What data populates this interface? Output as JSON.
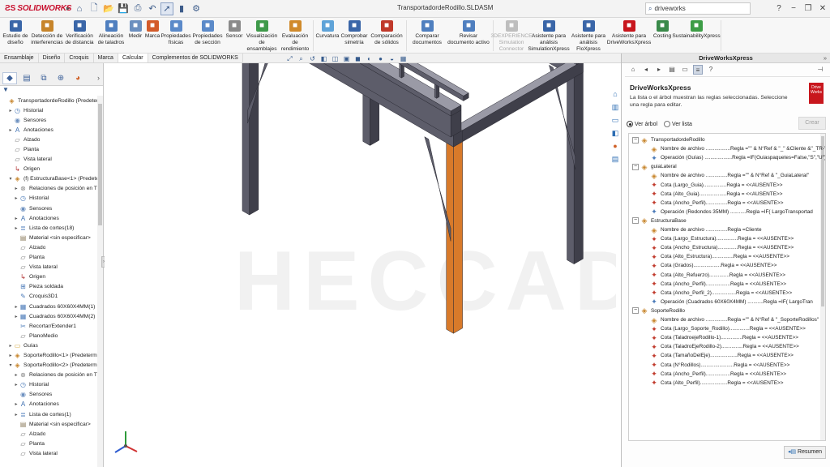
{
  "app": {
    "brand": "SOLIDWORKS",
    "doc_title": "TransportadordeRodillo.SLDASM",
    "search_text": "driveworks"
  },
  "ribbon": {
    "buttons": [
      {
        "label": "Estudio de diseño",
        "icon": "design-study-icon",
        "color": "#3a66a8"
      },
      {
        "label": "Detección de interferencias",
        "icon": "interference-icon",
        "color": "#c7852b"
      },
      {
        "label": "Verificación de distancia",
        "icon": "clearance-icon",
        "color": "#3a66a8"
      },
      {
        "label": "Alineación de taladros",
        "icon": "hole-align-icon",
        "color": "#4f7fbf"
      },
      {
        "label": "Medir",
        "icon": "measure-icon",
        "color": "#6b8fbf"
      },
      {
        "label": "Marca",
        "icon": "markup-icon",
        "color": "#d35b2a"
      },
      {
        "label": "Propiedades físicas",
        "icon": "mass-props-icon",
        "color": "#5b8ac9"
      },
      {
        "label": "Propiedades de sección",
        "icon": "section-props-icon",
        "color": "#5b8ac9"
      },
      {
        "label": "Sensor",
        "icon": "sensor-icon",
        "color": "#8a8a8a"
      },
      {
        "label": "Visualización de ensamblajes",
        "icon": "assembly-vis-icon",
        "color": "#3f9a4a"
      },
      {
        "label": "Evaluación de rendimiento",
        "icon": "performance-icon",
        "color": "#d08a2b"
      },
      {
        "label": "Curvatura",
        "icon": "curvature-icon",
        "color": "#5fa3d8"
      },
      {
        "label": "Comprobar simetría",
        "icon": "symmetry-icon",
        "color": "#3a66a8"
      },
      {
        "label": "Comparación de sólidos",
        "icon": "compare-solids-icon",
        "color": "#c0392b"
      },
      {
        "label": "Comparar documentos",
        "icon": "compare-docs-icon",
        "color": "#4f7fbf"
      },
      {
        "label": "Revisar documento activo",
        "icon": "check-doc-icon",
        "color": "#4f7fbf"
      },
      {
        "label": "3DEXPERIENCE Simulation Connector",
        "icon": "3dx-icon",
        "color": "#7a7a7a",
        "disabled": true
      },
      {
        "label": "Asistente para análisis SimulationXpress",
        "icon": "simxpress-icon",
        "color": "#3a66a8"
      },
      {
        "label": "Asistente para análisis FloXpress",
        "icon": "floxpress-icon",
        "color": "#3a66a8"
      },
      {
        "label": "Asistente para DriveWorksXpress",
        "icon": "driveworks-icon",
        "color": "#c8161d"
      },
      {
        "label": "Costing",
        "icon": "costing-icon",
        "color": "#3a8a4a"
      },
      {
        "label": "SustainabilityXpress",
        "icon": "sustainability-icon",
        "color": "#3d9d46"
      }
    ]
  },
  "cmd_tabs": [
    "Ensamblaje",
    "Diseño",
    "Croquis",
    "Marca",
    "Calcular",
    "Complementos de SOLIDWORKS"
  ],
  "cmd_tabs_active": 4,
  "feature_tree": [
    {
      "label": "TransportadordeRodillo  (Predetermi",
      "icon": "assembly-icon",
      "lvl": 0,
      "exp": ""
    },
    {
      "label": "Historial",
      "icon": "history-icon",
      "lvl": 1,
      "exp": "▸"
    },
    {
      "label": "Sensores",
      "icon": "sensor-icon",
      "lvl": 1,
      "exp": ""
    },
    {
      "label": "Anotaciones",
      "icon": "annotation-icon",
      "lvl": 1,
      "exp": "▸"
    },
    {
      "label": "Alzado",
      "icon": "plane-icon",
      "lvl": 1,
      "exp": ""
    },
    {
      "label": "Planta",
      "icon": "plane-icon",
      "lvl": 1,
      "exp": ""
    },
    {
      "label": "Vista lateral",
      "icon": "plane-icon",
      "lvl": 1,
      "exp": ""
    },
    {
      "label": "Origen",
      "icon": "origin-icon",
      "lvl": 1,
      "exp": ""
    },
    {
      "label": "(f) EstructuraBase<1> (Predetermi",
      "icon": "part-icon",
      "lvl": 1,
      "exp": "▾"
    },
    {
      "label": "Relaciones de posición en T",
      "icon": "mate-icon",
      "lvl": 2,
      "exp": "▸"
    },
    {
      "label": "Historial",
      "icon": "history-icon",
      "lvl": 2,
      "exp": "▸"
    },
    {
      "label": "Sensores",
      "icon": "sensor-icon",
      "lvl": 2,
      "exp": ""
    },
    {
      "label": "Anotaciones",
      "icon": "annotation-icon",
      "lvl": 2,
      "exp": "▸"
    },
    {
      "label": "Lista de cortes(18)",
      "icon": "cutlist-icon",
      "lvl": 2,
      "exp": "▸"
    },
    {
      "label": "Material <sin especificar>",
      "icon": "material-icon",
      "lvl": 2,
      "exp": ""
    },
    {
      "label": "Alzado",
      "icon": "plane-icon",
      "lvl": 2,
      "exp": ""
    },
    {
      "label": "Planta",
      "icon": "plane-icon",
      "lvl": 2,
      "exp": ""
    },
    {
      "label": "Vista lateral",
      "icon": "plane-icon",
      "lvl": 2,
      "exp": ""
    },
    {
      "label": "Origen",
      "icon": "origin-icon",
      "lvl": 2,
      "exp": ""
    },
    {
      "label": "Pieza soldada",
      "icon": "weldment-icon",
      "lvl": 2,
      "exp": ""
    },
    {
      "label": "Croquis3D1",
      "icon": "sketch-icon",
      "lvl": 2,
      "exp": ""
    },
    {
      "label": "Cuadrados 60X60X4MM(1)",
      "icon": "structural-icon",
      "lvl": 2,
      "exp": "▸"
    },
    {
      "label": "Cuadrados 60X60X4MM(2)",
      "icon": "structural-icon",
      "lvl": 2,
      "exp": "▸"
    },
    {
      "label": "Recortar/Extender1",
      "icon": "trim-icon",
      "lvl": 2,
      "exp": ""
    },
    {
      "label": "PlanoMedio",
      "icon": "plane-icon",
      "lvl": 2,
      "exp": ""
    },
    {
      "label": "Guías",
      "icon": "folder-icon",
      "lvl": 1,
      "exp": "▸"
    },
    {
      "label": "SoporteRodillo<1> (Predetermir",
      "icon": "part-icon",
      "lvl": 1,
      "exp": "▸"
    },
    {
      "label": "SoporteRodillo<2> (Predetermir",
      "icon": "part-icon",
      "lvl": 1,
      "exp": "▾"
    },
    {
      "label": "Relaciones de posición en T",
      "icon": "mate-icon",
      "lvl": 2,
      "exp": "▸"
    },
    {
      "label": "Historial",
      "icon": "history-icon",
      "lvl": 2,
      "exp": "▸"
    },
    {
      "label": "Sensores",
      "icon": "sensor-icon",
      "lvl": 2,
      "exp": ""
    },
    {
      "label": "Anotaciones",
      "icon": "annotation-icon",
      "lvl": 2,
      "exp": "▸"
    },
    {
      "label": "Lista de cortes(1)",
      "icon": "cutlist-icon",
      "lvl": 2,
      "exp": "▸"
    },
    {
      "label": "Material <sin especificar>",
      "icon": "material-icon",
      "lvl": 2,
      "exp": ""
    },
    {
      "label": "Alzado",
      "icon": "plane-icon",
      "lvl": 2,
      "exp": ""
    },
    {
      "label": "Planta",
      "icon": "plane-icon",
      "lvl": 2,
      "exp": ""
    },
    {
      "label": "Vista lateral",
      "icon": "plane-icon",
      "lvl": 2,
      "exp": ""
    }
  ],
  "viewport": {
    "watermark": "HECCAD"
  },
  "dwx": {
    "panel_title": "DriveWorksXpress",
    "heading": "DriveWorksXpress",
    "description": "La lista o el árbol muestran las reglas seleccionadas. Seleccione una regla para editar.",
    "logo_line1": "Drive",
    "logo_line2": "Works",
    "view_tree": "Ver árbol",
    "view_list": "Ver lista",
    "create_button": "Crear",
    "summary_button": "Resumen",
    "rules": [
      {
        "label": "TransportadordeRodillo",
        "lvl": 0,
        "type": "group"
      },
      {
        "label": "Nombre de archivo .................Regla =\"\" & N°Ref & \"_\" &Cliente &\"_TR-\"",
        "lvl": 1,
        "type": "rule"
      },
      {
        "label": "Operación  (Guías) ...................Regla =IF(Guiaspaquetes=False,\"S\",\"U\")",
        "lvl": 1,
        "type": "op"
      },
      {
        "label": "guiaLateral",
        "lvl": 0,
        "type": "group"
      },
      {
        "label": "Nombre de archivo ...............Regla =\"\" & N°Ref & \"_GuiaLateral\"",
        "lvl": 1,
        "type": "rule"
      },
      {
        "label": "Cota  (Largo_Guia)................Regla = <<AUSENTE>>",
        "lvl": 1,
        "type": "dim"
      },
      {
        "label": "Cota  (Alto_Guia)...................Regla = <<AUSENTE>>",
        "lvl": 1,
        "type": "dim"
      },
      {
        "label": "Cota  (Ancho_Perfil)...............Regla = <<AUSENTE>>",
        "lvl": 1,
        "type": "dim"
      },
      {
        "label": "Operación  (Redondos 35MM) ...........Regla =IF( LargoTransportad",
        "lvl": 1,
        "type": "op"
      },
      {
        "label": "EstructuraBase",
        "lvl": 0,
        "type": "group"
      },
      {
        "label": "Nombre de archivo ...............Regla =Cliente",
        "lvl": 1,
        "type": "rule"
      },
      {
        "label": "Cota  (Largo_Estructura)...............Regla = <<AUSENTE>>",
        "lvl": 1,
        "type": "dim"
      },
      {
        "label": "Cota  (Ancho_Estructura)..............Regla = <<AUSENTE>>",
        "lvl": 1,
        "type": "dim"
      },
      {
        "label": "Cota  (Alto_Estructura)...............Regla = <<AUSENTE>>",
        "lvl": 1,
        "type": "dim"
      },
      {
        "label": "Cota  (Grados)...................Regla = <<AUSENTE>>",
        "lvl": 1,
        "type": "dim"
      },
      {
        "label": "Cota  (Alto_Refuerzo)..............Regla = <<AUSENTE>>",
        "lvl": 1,
        "type": "dim"
      },
      {
        "label": "Cota  (Ancho_Perfil).................Regla = <<AUSENTE>>",
        "lvl": 1,
        "type": "dim"
      },
      {
        "label": "Cota  (Ancho_Perfil_2).................Regla = <<AUSENTE>>",
        "lvl": 1,
        "type": "dim"
      },
      {
        "label": "Operación  (Cuadrados 60X60X4MM) ...........Regla =IF( LargoTran",
        "lvl": 1,
        "type": "op"
      },
      {
        "label": "SoporteRodillo",
        "lvl": 0,
        "type": "group"
      },
      {
        "label": "Nombre de archivo ...............Regla =\"\" & N°Ref & \"_SoporteRodillos\"",
        "lvl": 1,
        "type": "rule"
      },
      {
        "label": "Cota  (Largo_Soporte_Rodillo)..............Regla = <<AUSENTE>>",
        "lvl": 1,
        "type": "dim"
      },
      {
        "label": "Cota  (TaladroejeRodillo-1)...............Regla = <<AUSENTE>>",
        "lvl": 1,
        "type": "dim"
      },
      {
        "label": "Cota  (TaladroEjeRodillo-2)...............Regla = <<AUSENTE>>",
        "lvl": 1,
        "type": "dim"
      },
      {
        "label": "Cota  (TamañoDelEje)...................Regla = <<AUSENTE>>",
        "lvl": 1,
        "type": "dim"
      },
      {
        "label": "Cota  (N°Rodillos).......................Regla = <<AUSENTE>>",
        "lvl": 1,
        "type": "dim"
      },
      {
        "label": "Cota  (Ancho_Perfil).................Regla = <<AUSENTE>>",
        "lvl": 1,
        "type": "dim"
      },
      {
        "label": "Cota  (Alto_Perfil)...................Regla = <<AUSENTE>>",
        "lvl": 1,
        "type": "dim"
      }
    ]
  },
  "colors": {
    "steel_top": "#9a9aa6",
    "steel_side": "#5d5d6a",
    "steel_dark": "#3f3f4a",
    "highlight_orange": "#d87a2a",
    "accent_blue": "#2c6db3",
    "brand_red": "#c8102e"
  }
}
